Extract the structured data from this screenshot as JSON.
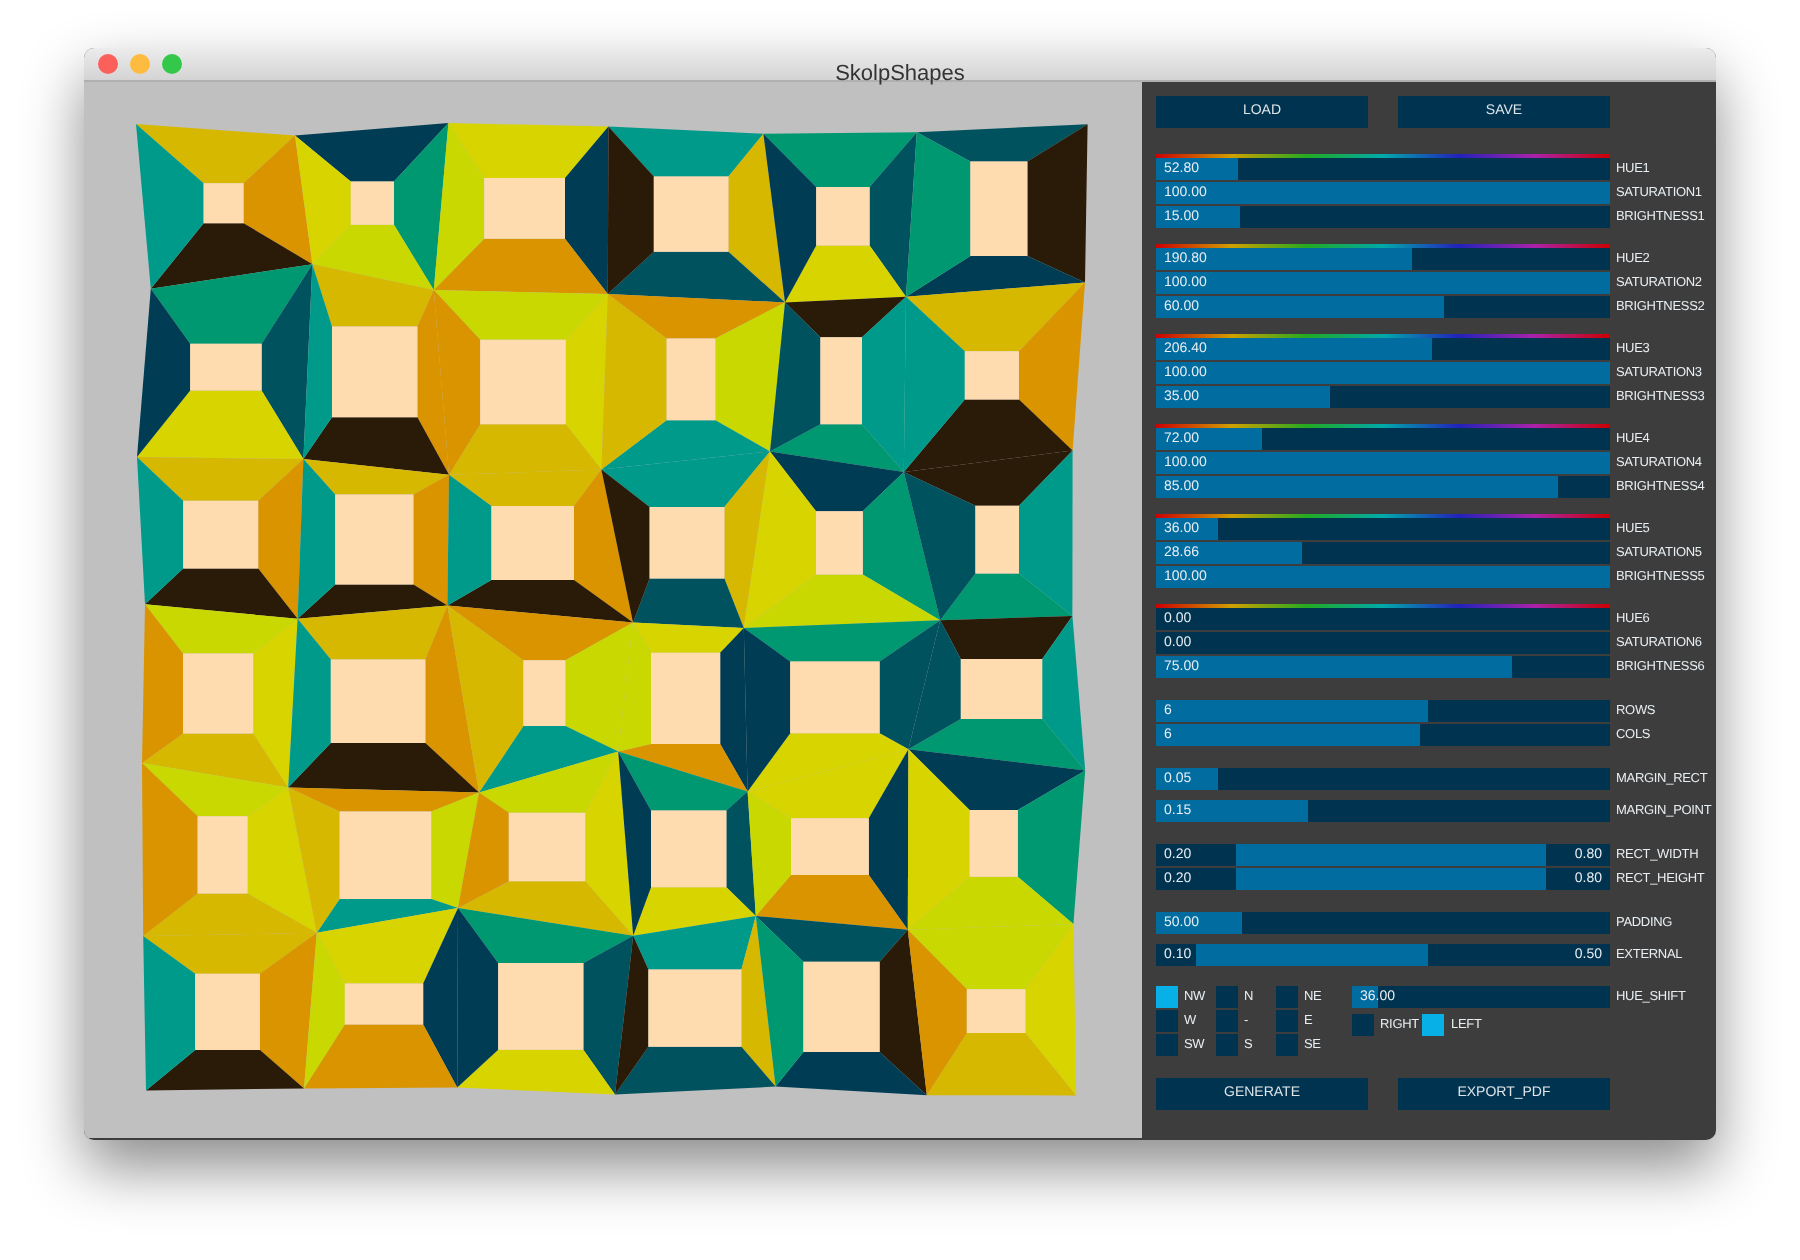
{
  "window": {
    "title": "SkolpShapes"
  },
  "file_buttons": [
    "LOAD",
    "SAVE"
  ],
  "groups": [
    {
      "kind": "color",
      "rows": [
        {
          "kind": "slider",
          "label": "HUE1",
          "value": "52.80",
          "level": 0.18
        },
        {
          "kind": "slider",
          "label": "SATURATION1",
          "value": "100.00",
          "level": 1
        },
        {
          "kind": "slider",
          "label": "BRIGHTNESS1",
          "value": "15.00",
          "level": 0.187
        }
      ]
    },
    {
      "kind": "color",
      "rows": [
        {
          "kind": "slider",
          "label": "HUE2",
          "value": "190.80",
          "level": 0.566
        },
        {
          "kind": "slider",
          "label": "SATURATION2",
          "value": "100.00",
          "level": 1
        },
        {
          "kind": "slider",
          "label": "BRIGHTNESS2",
          "value": "60.00",
          "level": 0.635
        }
      ]
    },
    {
      "kind": "color",
      "rows": [
        {
          "kind": "slider",
          "label": "HUE3",
          "value": "206.40",
          "level": 0.61
        },
        {
          "kind": "slider",
          "label": "SATURATION3",
          "value": "100.00",
          "level": 1
        },
        {
          "kind": "slider",
          "label": "BRIGHTNESS3",
          "value": "35.00",
          "level": 0.385
        }
      ]
    },
    {
      "kind": "color",
      "rows": [
        {
          "kind": "slider",
          "label": "HUE4",
          "value": "72.00",
          "level": 0.235
        },
        {
          "kind": "slider",
          "label": "SATURATION4",
          "value": "100.00",
          "level": 1
        },
        {
          "kind": "slider",
          "label": "BRIGHTNESS4",
          "value": "85.00",
          "level": 0.885
        }
      ]
    },
    {
      "kind": "color",
      "rows": [
        {
          "kind": "slider",
          "label": "HUE5",
          "value": "36.00",
          "level": 0.135
        },
        {
          "kind": "slider",
          "label": "SATURATION5",
          "value": "28.66",
          "level": 0.32
        },
        {
          "kind": "slider",
          "label": "BRIGHTNESS5",
          "value": "100.00",
          "level": 1
        }
      ]
    },
    {
      "kind": "color",
      "rows": [
        {
          "kind": "slider",
          "label": "HUE6",
          "value": "0.00",
          "level": 0
        },
        {
          "kind": "slider",
          "label": "SATURATION6",
          "value": "0.00",
          "level": 0
        },
        {
          "kind": "slider",
          "label": "BRIGHTNESS6",
          "value": "75.00",
          "level": 0.785
        }
      ]
    },
    {
      "kind": "plain",
      "rows": [
        {
          "kind": "slider",
          "label": "ROWS",
          "value": "6",
          "level": 0.6
        },
        {
          "kind": "slider",
          "label": "COLS",
          "value": "6",
          "level": 0.58
        }
      ]
    },
    {
      "kind": "plain",
      "rows": [
        {
          "kind": "slider",
          "label": "MARGIN_RECT",
          "value": "0.05",
          "level": 0.135
        },
        {
          "kind": "slider",
          "label": "MARGIN_POINT",
          "value": "0.15",
          "level": 0.335
        }
      ]
    },
    {
      "kind": "plain",
      "rows": [
        {
          "kind": "range",
          "label": "RECT_WIDTH",
          "low": "0.20",
          "high": "0.80",
          "handles": [
            {
              "level": 0.176
            },
            {
              "level": 0.86
            }
          ]
        },
        {
          "kind": "range",
          "label": "RECT_HEIGHT",
          "low": "0.20",
          "high": "0.80",
          "handles": [
            {
              "level": 0.176
            },
            {
              "level": 0.86
            }
          ]
        }
      ]
    },
    {
      "kind": "plain",
      "rows": [
        {
          "kind": "slider",
          "label": "PADDING",
          "value": "50.00",
          "level": 0.19
        },
        {
          "kind": "range",
          "label": "EXTERNAL",
          "low": "0.10",
          "high": "0.50",
          "handles": [
            {
              "level": 0.09
            },
            {
              "level": 0.6
            }
          ]
        }
      ]
    }
  ],
  "directions": [
    {
      "label": "NW",
      "checked": true
    },
    {
      "label": "N",
      "checked": false
    },
    {
      "label": "NE",
      "checked": false
    },
    {
      "label": "W",
      "checked": false
    },
    {
      "label": "-",
      "checked": false
    },
    {
      "label": "E",
      "checked": false
    },
    {
      "label": "SW",
      "checked": false
    },
    {
      "label": "S",
      "checked": false
    },
    {
      "label": "SE",
      "checked": false
    }
  ],
  "hue_shift": {
    "label": "HUE_SHIFT",
    "value": "36.00",
    "level": 0.1
  },
  "shift_direction": [
    {
      "label": "RIGHT",
      "checked": false
    },
    {
      "label": "LEFT",
      "checked": true
    }
  ],
  "action_buttons": [
    "GENERATE",
    "EXPORT_PDF"
  ]
}
